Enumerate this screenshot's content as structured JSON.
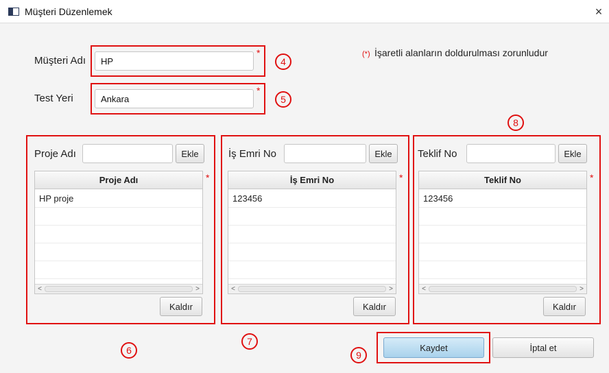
{
  "window": {
    "title": "Müşteri Düzenlemek",
    "close_glyph": "×"
  },
  "form": {
    "customer_label": "Müşteri Adı",
    "customer_value": "HP",
    "location_label": "Test Yeri",
    "location_value": "Ankara",
    "required_asterisk": "*",
    "required_note_marker": "(*)",
    "required_note": "İşaretli alanların doldurulması zorunludur"
  },
  "panels": [
    {
      "label": "Proje Adı",
      "input_value": "",
      "add_label": "Ekle",
      "column_header": "Proje Adı",
      "rows": [
        "HP proje"
      ],
      "remove_label": "Kaldır"
    },
    {
      "label": "İş Emri No",
      "input_value": "",
      "add_label": "Ekle",
      "column_header": "İş Emri No",
      "rows": [
        "123456"
      ],
      "remove_label": "Kaldır"
    },
    {
      "label": "Teklif No",
      "input_value": "",
      "add_label": "Ekle",
      "column_header": "Teklif No",
      "rows": [
        "123456"
      ],
      "remove_label": "Kaldır"
    }
  ],
  "actions": {
    "save_label": "Kaydet",
    "cancel_label": "İptal et"
  },
  "annotations": {
    "n4": "4",
    "n5": "5",
    "n6": "6",
    "n7": "7",
    "n8": "8",
    "n9": "9"
  },
  "scroll": {
    "left_arrow": "<",
    "right_arrow": ">"
  },
  "colors": {
    "annotation": "#e01010",
    "primary_button": "#a9d2ec"
  }
}
